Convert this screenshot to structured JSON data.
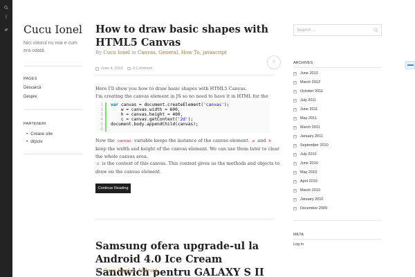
{
  "social": {
    "icons": [
      "search-icon",
      "facebook-icon",
      "twitter-icon"
    ]
  },
  "site": {
    "title": "Cucu Ionel",
    "description": "Nici viitorul nu mai e cum era odată."
  },
  "sidebar": {
    "pages_heading": "PAGES",
    "pages": [
      "Descarcă",
      "Despre"
    ],
    "partners_heading": "PARTENERI",
    "partners": [
      "Creare site",
      "drpciv"
    ]
  },
  "post1": {
    "title": "How to draw basic shapes with HTML5 Canvas",
    "meta_by": "By",
    "author": "Cucu Ionel",
    "meta_in": "in",
    "categories": [
      "Canvas",
      "General",
      "How To",
      "javascript"
    ],
    "date": "June 4, 2013",
    "comments": "0 Comment",
    "comment_count": "0",
    "intro1": "Here I'll show you how to draw basic shapes with HTML5 Canvas.",
    "intro2": "I'm creating the canvas element in JS so no need to have it in HTML for the moment.",
    "code_line_numbers": [
      "1",
      "2",
      "3",
      "4",
      "5",
      "6"
    ],
    "code": {
      "l1_kw": "var",
      "l1_a": " canvas = document.createElement(",
      "l1_str": "'canvas'",
      "l1_b": ");",
      "l2": "    w = canvas.width = 600,",
      "l3": "    h = canvas.height = 400,",
      "l4_a": "    c = canvas.getContext(",
      "l4_str": "'2d'",
      "l4_b": ");",
      "l5": "",
      "l6": "document.body.appendChild(canvas);"
    },
    "p2_a": "Now the ",
    "code_canvas": "canvas",
    "p2_b": " variable keeps the instance of the canvas element. ",
    "code_w": "w",
    "p2_c": " and ",
    "code_h": "h",
    "p2_d": " keep the width and height of the canvas element. We can use them later to clear the whole canvas area.",
    "code_c": "c",
    "p3": " is the context of this canvas. This context gives us the methods and objects to draw on the canvas element.",
    "button_label": "Continue Reading"
  },
  "post2": {
    "title": "Samsung ofera upgrade-ul la Android 4.0 Ice Cream Sandwich pentru GALAXY S II",
    "meta_by": "By",
    "author": "Cucu Ionel",
    "meta_in": "in",
    "category": "Android"
  },
  "right_sidebar": {
    "search_placeholder": "Search ...",
    "archives_heading": "ARCHIVES",
    "archives": [
      "June 2013",
      "March 2012",
      "October 2011",
      "July 2011",
      "June 2011",
      "May 2011",
      "March 2011",
      "January 2011",
      "September 2010",
      "July 2010",
      "June 2010",
      "May 2010",
      "April 2010",
      "March 2010",
      "January 2010",
      "December 2009"
    ],
    "meta_heading": "META",
    "meta_links": [
      "Log in"
    ]
  }
}
